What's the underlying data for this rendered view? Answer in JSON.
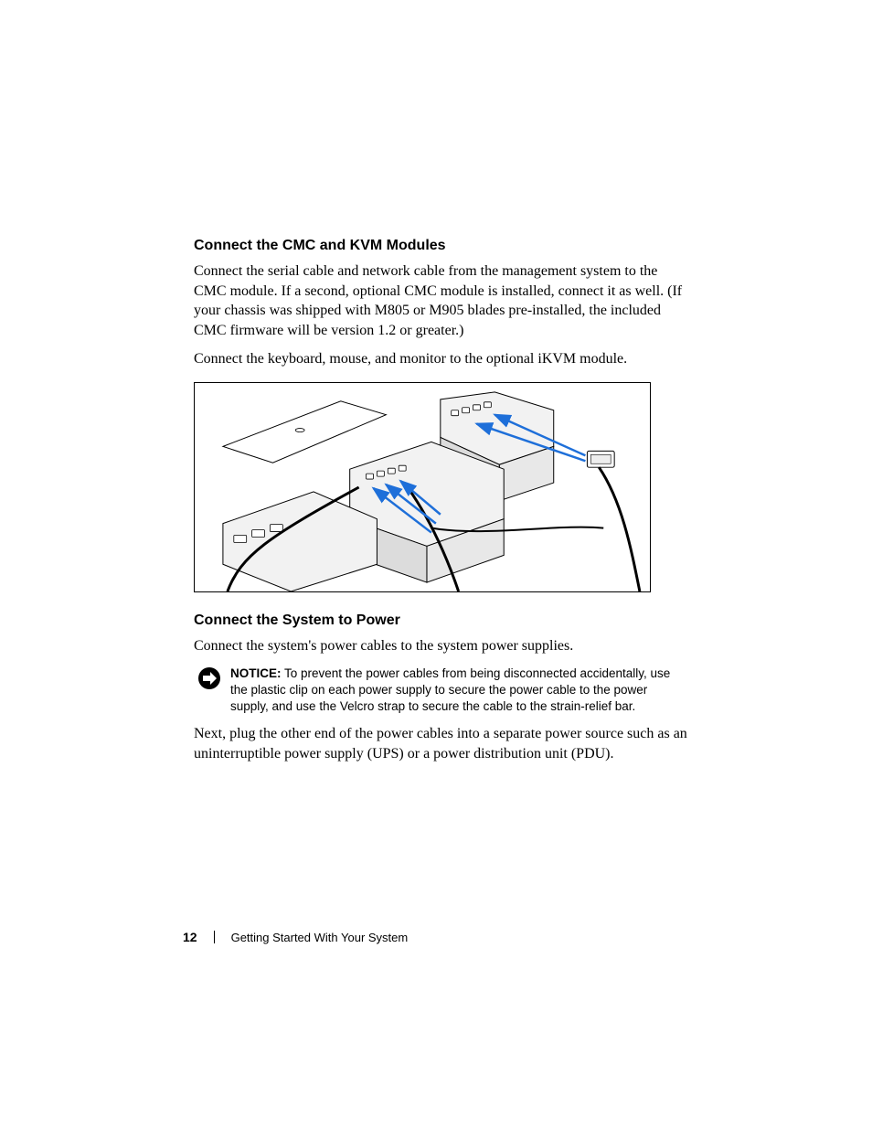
{
  "section1": {
    "heading": "Connect the CMC and KVM Modules",
    "p1": "Connect the serial cable and network cable from the management system to the CMC module. If a second, optional CMC module is installed, connect it as well. (If your chassis was shipped with M805 or M905 blades pre-installed, the included CMC firmware will be version 1.2 or greater.)",
    "p2": "Connect the keyboard, mouse, and monitor to the optional iKVM module."
  },
  "section2": {
    "heading": "Connect the System to Power",
    "p1": "Connect the system's power cables to the system power supplies.",
    "notice_label": "NOTICE:",
    "notice_body": " To prevent the power cables from being disconnected accidentally, use the plastic clip on each power supply to secure the power cable to the power supply, and use the Velcro strap to secure the cable to the strain-relief bar.",
    "p2": "Next, plug the other end of the power cables into a separate power source such as an uninterruptible power supply (UPS) or a power distribution unit (PDU)."
  },
  "footer": {
    "page_number": "12",
    "title": "Getting Started With Your System"
  }
}
